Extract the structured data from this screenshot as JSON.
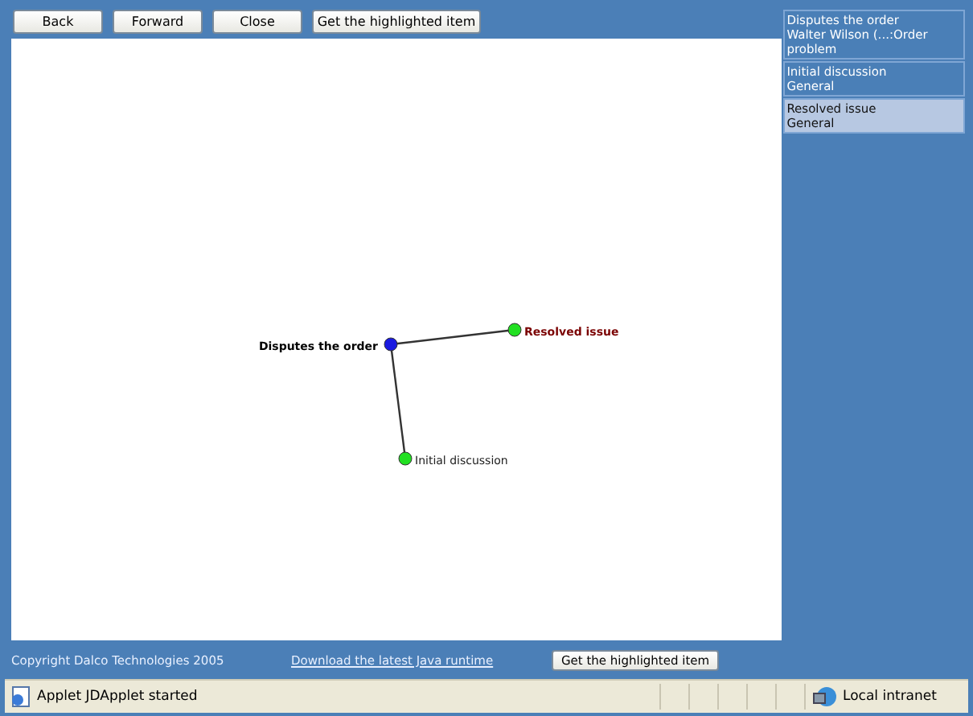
{
  "toolbar": [
    "Back",
    "Forward",
    "Close",
    "Get the highlighted item"
  ],
  "graph": {
    "nodes": [
      {
        "label": "Disputes the order",
        "kind": "root",
        "selected": false
      },
      {
        "label": "Resolved issue",
        "kind": "child",
        "selected": true
      },
      {
        "label": "Initial discussion",
        "kind": "child",
        "selected": false
      }
    ]
  },
  "list": [
    {
      "lines": [
        "Disputes the order",
        "Walter Wilson (...:Order problem"
      ],
      "selected": false
    },
    {
      "lines": [
        "Initial discussion",
        "General"
      ],
      "selected": false
    },
    {
      "lines": [
        "Resolved issue",
        "General"
      ],
      "selected": true
    }
  ],
  "footer": {
    "copyright": "Copyright Dalco Technologies 2005",
    "link": "Download the latest Java runtime",
    "button": "Get the highlighted item"
  },
  "status_bar": {
    "message": "Applet JDApplet started",
    "zone": "Local intranet"
  }
}
